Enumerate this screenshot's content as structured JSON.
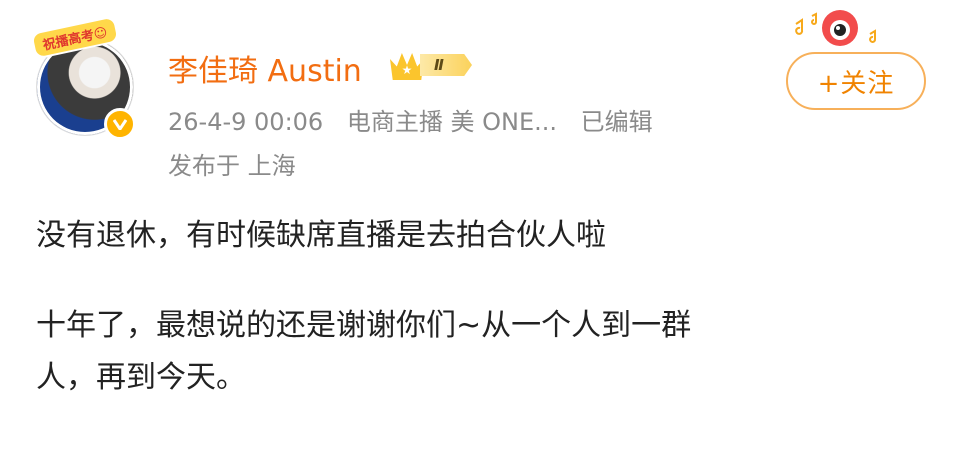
{
  "avatar": {
    "frame_badge": "祝播高考☺"
  },
  "user": {
    "name": "李佳琦 Austin",
    "vip_level": "Ⅱ"
  },
  "meta": {
    "date": "26-4-9 00:06",
    "tag": "电商主播 美 ONE...",
    "edited": "已编辑",
    "location": "发布于 上海"
  },
  "follow_button": {
    "label": "+关注"
  },
  "post": {
    "line1": "没有退休，有时候缺席直播是去拍合伙人啦",
    "line2": "十年了，最想说的还是谢谢你们~从一个人到一群",
    "line3": "人，再到今天。"
  },
  "colors": {
    "username": "#f26d11",
    "follow": "#f08300",
    "meta": "#8a8a8a"
  },
  "icons": [
    "frame-badge",
    "verified-v-icon",
    "crown-icon",
    "camera-logo-icon"
  ]
}
